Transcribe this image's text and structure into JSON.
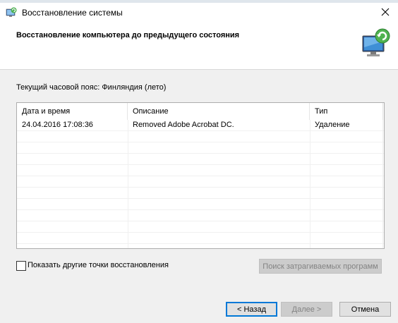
{
  "window": {
    "title": "Восстановление системы",
    "close_icon": "close-icon",
    "app_icon": "system-restore-icon"
  },
  "header": {
    "title": "Восстановление компьютера до предыдущего состояния",
    "icon": "system-restore-monitor-icon"
  },
  "timezone": {
    "label": "Текущий часовой пояс: Финляндия (лето)"
  },
  "table": {
    "columns": [
      "Дата и время",
      "Описание",
      "Тип"
    ],
    "rows": [
      [
        "24.04.2016 17:08:36",
        "Removed Adobe Acrobat DC.",
        "Удаление"
      ]
    ]
  },
  "options": {
    "show_more_label": "Показать другие точки восстановления",
    "show_more_checked": false
  },
  "buttons": {
    "scan": "Поиск затрагиваемых программ",
    "back": "< Назад",
    "next": "Далее >",
    "cancel": "Отмена"
  },
  "colors": {
    "accent": "#0078d7",
    "dialog_bg": "#f0f0f0"
  }
}
